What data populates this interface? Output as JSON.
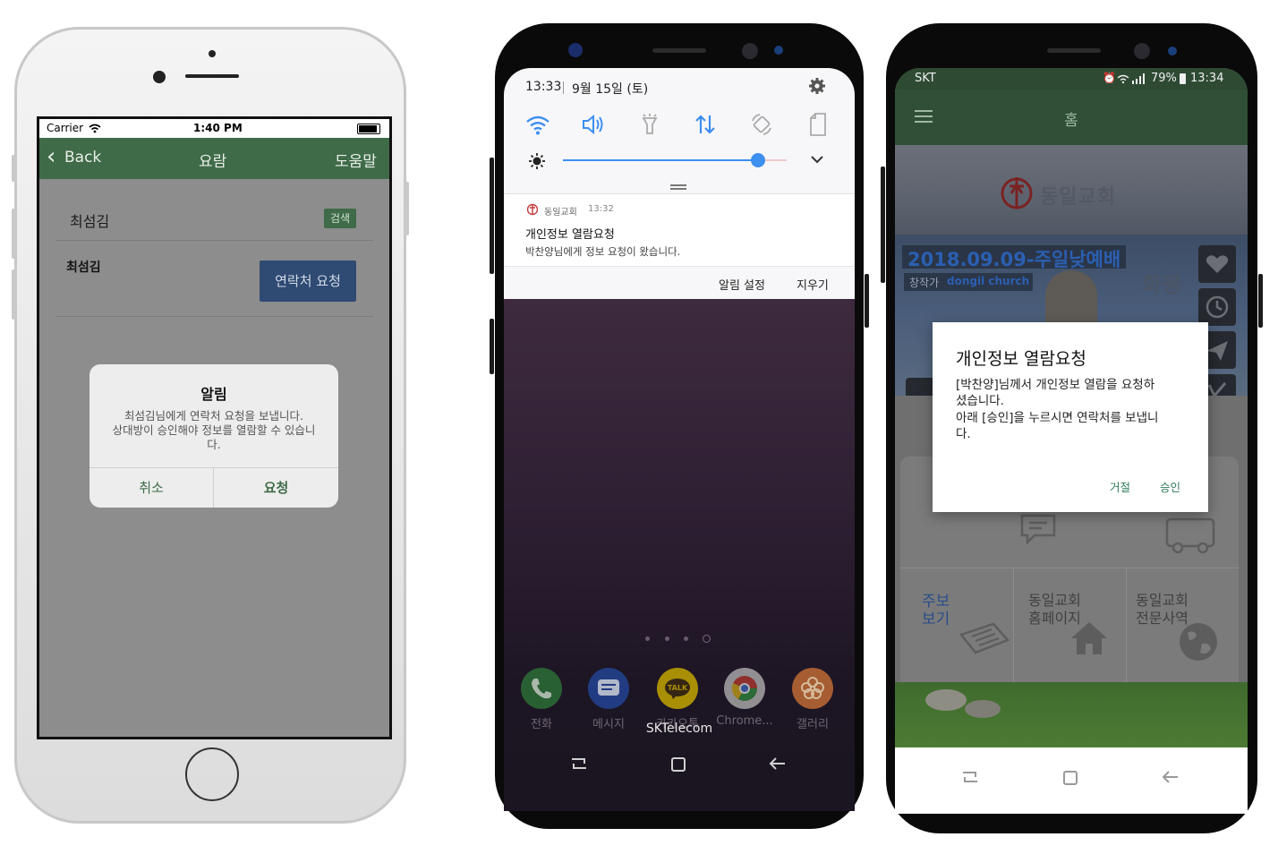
{
  "iphone": {
    "status": {
      "carrier": "Carrier",
      "time": "1:40 PM"
    },
    "nav": {
      "back": "Back",
      "title": "요람",
      "help": "도움말"
    },
    "search": {
      "name": "최섬김",
      "button": "검색"
    },
    "result": {
      "name": "최섬김",
      "button": "연락처 요청"
    },
    "alert": {
      "title": "알림",
      "line1": "최섬김님에게 연락처 요청을 보냅니다.",
      "line2": "상대방이 승인해야 정보를 열람할 수 있습니",
      "line3": "다.",
      "cancel": "취소",
      "confirm": "요청"
    },
    "colors": {
      "nav": "#3f6b48",
      "search_button": "#3f6b48",
      "request_button": "#2f4a73"
    }
  },
  "android_notification": {
    "status": {
      "time": "13:33",
      "date": "9월 15일 (토)"
    },
    "brightness": 0.87,
    "notification": {
      "app": "동일교회",
      "time": "13:32",
      "title": "개인정보 열람요청",
      "body": "박찬양님에게 정보 요청이 왔습니다."
    },
    "actions": {
      "settings": "알림 설정",
      "clear": "지우기"
    },
    "dock": [
      {
        "label": "전화",
        "icon": "phone-icon",
        "color": "#3fa34d"
      },
      {
        "label": "메시지",
        "icon": "message-icon",
        "color": "#2f5fb8"
      },
      {
        "label": "카카오톡",
        "icon": "kakaotalk-icon",
        "color": "#f6d400"
      },
      {
        "label": "Chrome...",
        "icon": "chrome-icon",
        "color": "#e8e8e8"
      },
      {
        "label": "갤러리",
        "icon": "gallery-icon",
        "color": "#f08a4b"
      }
    ],
    "carrier_text": "SKTelecom",
    "accent": "#3d8ff0"
  },
  "android_dialog": {
    "status": {
      "carrier": "SKT",
      "battery": "79%",
      "time": "13:34"
    },
    "header": {
      "title": "홈"
    },
    "banner": {
      "church_name": "동일교회",
      "date_title": "2018.09.09-주일낮예배",
      "subtitle_prefix": "창작가",
      "subtitle": "dongil church",
      "side_word": "화평"
    },
    "dialog": {
      "title": "개인정보 열람요청",
      "line1": "[박찬양]님께서 개인정보 열람을 요청하",
      "line2": "셨습니다.",
      "line3": "아래 [승인]을 누르시면 연락처를 보냅니",
      "line4": "다.",
      "reject": "거절",
      "approve": "승인"
    },
    "tiles": [
      {
        "label1": "주보",
        "label2": "보기",
        "icon": "newspaper-icon"
      },
      {
        "label1": "동일교회",
        "label2": "홈페이지",
        "icon": "house-icon"
      },
      {
        "label1": "동일교회",
        "label2": "전문사역",
        "icon": "globe-icon"
      }
    ],
    "colors": {
      "header": "#3f6b48",
      "banner_text": "#2b5fb0",
      "dialog_button": "#2f7a5a"
    }
  }
}
